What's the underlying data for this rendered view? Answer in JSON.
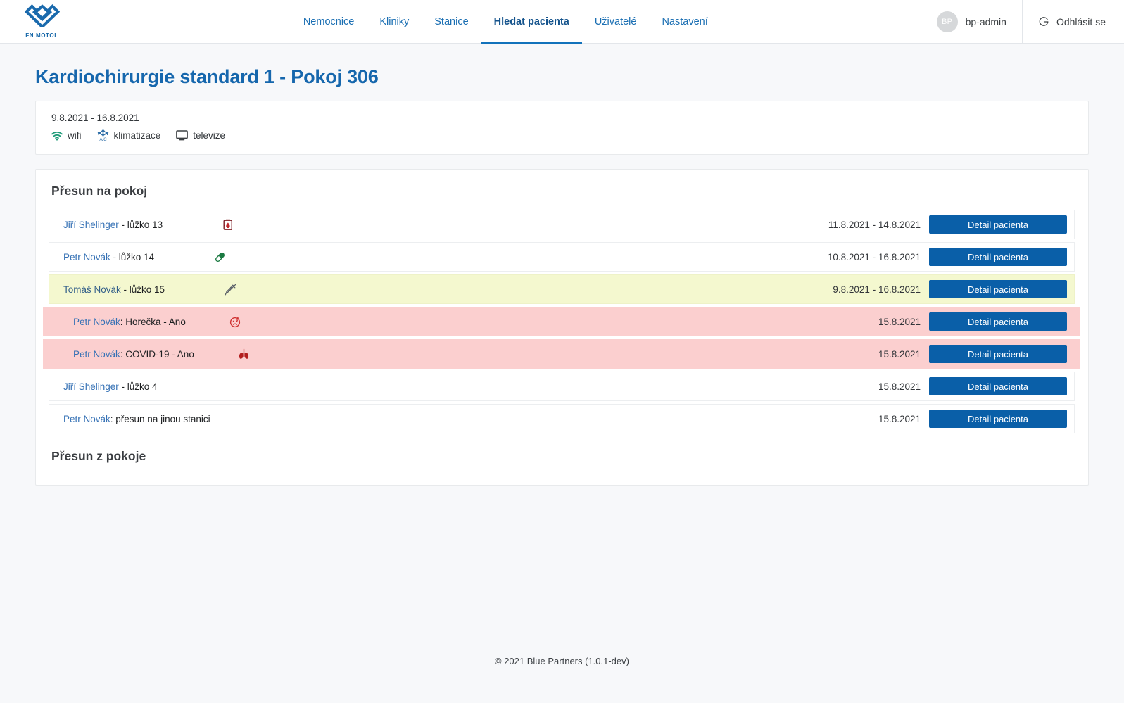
{
  "header": {
    "brand": {
      "name": "FN MOTOL",
      "icon": "fn-motol-logo-icon"
    },
    "nav": [
      {
        "label": "Nemocnice",
        "active": false
      },
      {
        "label": "Kliniky",
        "active": false
      },
      {
        "label": "Stanice",
        "active": false
      },
      {
        "label": "Hledat pacienta",
        "active": true
      },
      {
        "label": "Uživatelé",
        "active": false
      },
      {
        "label": "Nastavení",
        "active": false
      }
    ],
    "user": {
      "initials": "BP",
      "name": "bp-admin"
    },
    "logout": {
      "label": "Odhlásit se",
      "icon": "logout-icon"
    }
  },
  "page": {
    "title": "Kardiochirurgie standard 1 - Pokoj 306"
  },
  "info": {
    "dates": "9.8.2021 - 16.8.2021",
    "amenities": [
      {
        "label": "wifi",
        "icon": "wifi-icon"
      },
      {
        "label": "klimatizace",
        "icon": "air-conditioning-icon"
      },
      {
        "label": "televize",
        "icon": "television-icon"
      }
    ]
  },
  "transfers": {
    "section_in_title": "Přesun na pokoj",
    "section_out_title": "Přesun z pokoje",
    "button_label": "Detail pacienta",
    "rows": [
      {
        "patient": "Jiří Shelinger",
        "suffix": " - lůžko 13",
        "icon": "blood-bag-icon",
        "date": "11.8.2021 - 14.8.2021",
        "style": "plain"
      },
      {
        "patient": "Petr Novák",
        "suffix": " - lůžko 14",
        "icon": "pill-icon",
        "date": "10.8.2021 - 16.8.2021",
        "style": "plain"
      },
      {
        "patient": "Tomáš Novák",
        "suffix": " - lůžko 15",
        "icon": "syringe-icon",
        "date": "9.8.2021 - 16.8.2021",
        "style": "warn"
      },
      {
        "patient": "Petr Novák",
        "suffix": ": Horečka - Ano",
        "icon": "fever-face-icon",
        "date": "15.8.2021",
        "style": "alert"
      },
      {
        "patient": "Petr Novák",
        "suffix": ": COVID-19 - Ano",
        "icon": "lungs-icon",
        "date": "15.8.2021",
        "style": "alert"
      },
      {
        "patient": "Jiří Shelinger",
        "suffix": " - lůžko 4",
        "icon": "none",
        "date": "15.8.2021",
        "style": "plain"
      },
      {
        "patient": "Petr Novák",
        "suffix": ": přesun na jinou stanici",
        "icon": "none",
        "date": "15.8.2021",
        "style": "plain"
      }
    ]
  },
  "footer": {
    "text": "© 2021 Blue Partners (1.0.1-dev)"
  },
  "colors": {
    "brand_blue": "#1667ad",
    "link_blue": "#3571b5",
    "button_blue": "#0a5fa8",
    "warn_yellow": "#f4f8cf",
    "alert_pink": "#fbcfcf",
    "page_bg": "#f7f8fa"
  }
}
